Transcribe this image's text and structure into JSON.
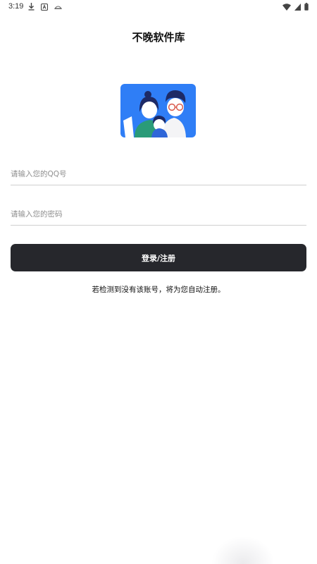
{
  "status_bar": {
    "time": "3:19",
    "left_icons": [
      "download-icon",
      "app-a-icon",
      "hat-icon"
    ],
    "right_icons": [
      "wifi-icon",
      "signal-icon",
      "battery-icon"
    ]
  },
  "header": {
    "title": "不晚软件库"
  },
  "login_form": {
    "qq_placeholder": "请输入您的QQ号",
    "password_placeholder": "请输入您的密码",
    "submit_label": "登录/注册",
    "hint": "若检测到没有该账号，将为您自动注册。"
  },
  "colors": {
    "illustration_bg": "#2f7ef6",
    "button_bg": "#26272c",
    "divider": "#cfcfcf"
  }
}
